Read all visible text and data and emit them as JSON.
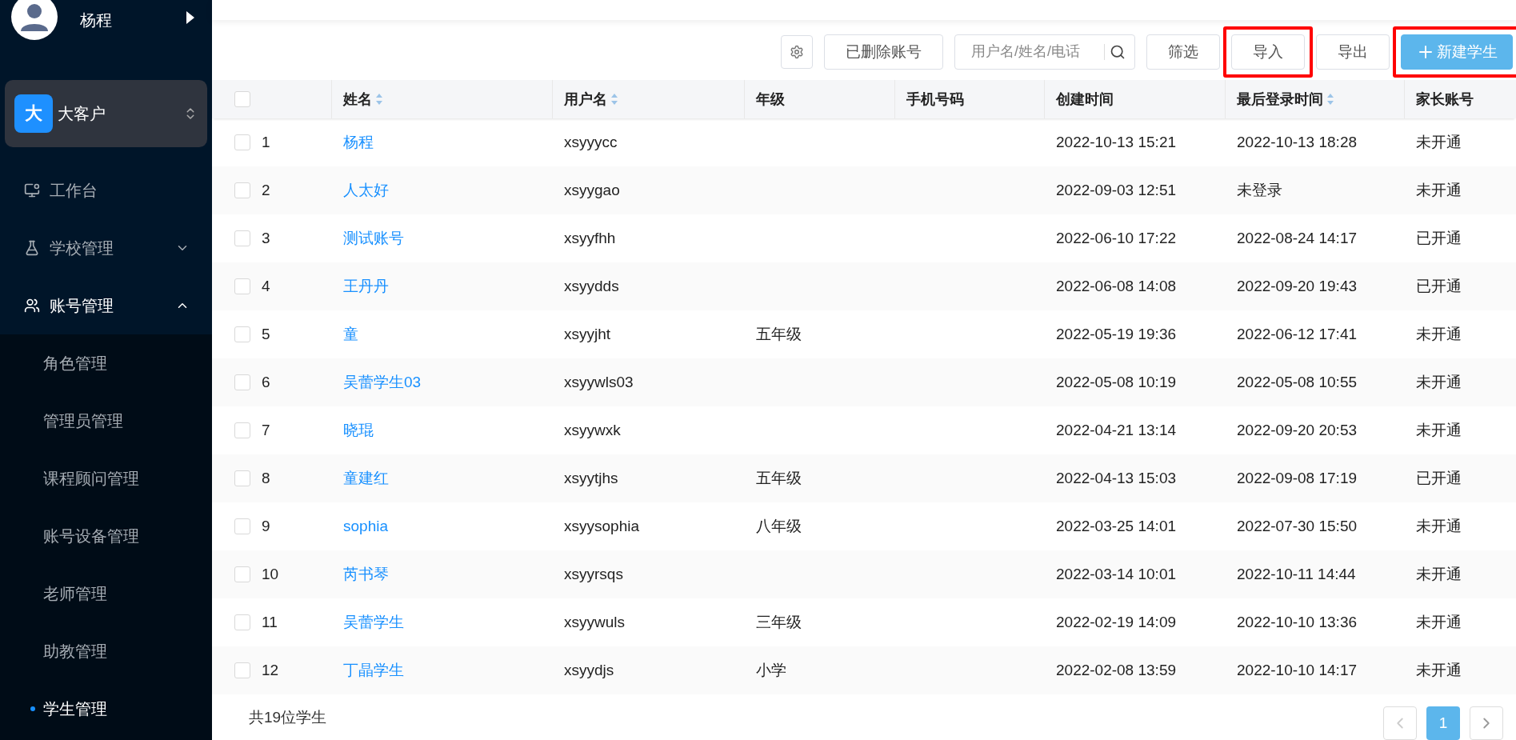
{
  "sidebar": {
    "user": {
      "name": "杨程"
    },
    "org": {
      "badge": "大",
      "name": "大客户"
    },
    "menu": [
      {
        "label": "工作台",
        "expanded": false,
        "has_children": false
      },
      {
        "label": "学校管理",
        "expanded": false,
        "has_children": true
      },
      {
        "label": "账号管理",
        "expanded": true,
        "has_children": true,
        "children": [
          {
            "label": "角色管理",
            "selected": false
          },
          {
            "label": "管理员管理",
            "selected": false
          },
          {
            "label": "课程顾问管理",
            "selected": false
          },
          {
            "label": "账号设备管理",
            "selected": false
          },
          {
            "label": "老师管理",
            "selected": false
          },
          {
            "label": "助教管理",
            "selected": false
          },
          {
            "label": "学生管理",
            "selected": true
          }
        ]
      }
    ]
  },
  "toolbar": {
    "buttons": [
      {
        "kind": "icon",
        "highlighted": false
      },
      {
        "kind": "default",
        "label": "已删除账号",
        "highlighted": false
      },
      {
        "kind": "search",
        "placeholder": "用户名/姓名/电话",
        "highlighted": false
      },
      {
        "kind": "default",
        "label": "筛选",
        "highlighted": false
      },
      {
        "kind": "default",
        "label": "导入",
        "highlighted": true
      },
      {
        "kind": "default",
        "label": "导出",
        "highlighted": false
      },
      {
        "kind": "primary",
        "label": "新建学生",
        "highlighted": true
      }
    ]
  },
  "table": {
    "all_checked": false,
    "columns": [
      {
        "label": "姓名",
        "sortable": true
      },
      {
        "label": "用户名",
        "sortable": true
      },
      {
        "label": "年级",
        "sortable": false
      },
      {
        "label": "手机号码",
        "sortable": false
      },
      {
        "label": "创建时间",
        "sortable": false
      },
      {
        "label": "最后登录时间",
        "sortable": true
      },
      {
        "label": "家长账号",
        "sortable": false
      }
    ],
    "rows": [
      {
        "checked": false,
        "index": "1",
        "cells": [
          "杨程",
          "xsyyycc",
          "",
          "",
          "2022-10-13 15:21",
          "2022-10-13 18:28",
          "未开通"
        ]
      },
      {
        "checked": false,
        "index": "2",
        "cells": [
          "人太好",
          "xsyygao",
          "",
          "",
          "2022-09-03 12:51",
          "未登录",
          "未开通"
        ]
      },
      {
        "checked": false,
        "index": "3",
        "cells": [
          "测试账号",
          "xsyyfhh",
          "",
          "",
          "2022-06-10 17:22",
          "2022-08-24 14:17",
          "已开通"
        ]
      },
      {
        "checked": false,
        "index": "4",
        "cells": [
          "王丹丹",
          "xsyydds",
          "",
          "",
          "2022-06-08 14:08",
          "2022-09-20 19:43",
          "已开通"
        ]
      },
      {
        "checked": false,
        "index": "5",
        "cells": [
          "童",
          "xsyyjht",
          "五年级",
          "",
          "2022-05-19 19:36",
          "2022-06-12 17:41",
          "未开通"
        ]
      },
      {
        "checked": false,
        "index": "6",
        "cells": [
          "吴蕾学生03",
          "xsyywls03",
          "",
          "",
          "2022-05-08 10:19",
          "2022-05-08 10:55",
          "未开通"
        ]
      },
      {
        "checked": false,
        "index": "7",
        "cells": [
          "晓琨",
          "xsyywxk",
          "",
          "",
          "2022-04-21 13:14",
          "2022-09-20 20:53",
          "未开通"
        ]
      },
      {
        "checked": false,
        "index": "8",
        "cells": [
          "童建红",
          "xsyytjhs",
          "五年级",
          "",
          "2022-04-13 15:03",
          "2022-09-08 17:19",
          "已开通"
        ]
      },
      {
        "checked": false,
        "index": "9",
        "cells": [
          "sophia",
          "xsyysophia",
          "八年级",
          "",
          "2022-03-25 14:01",
          "2022-07-30 15:50",
          "未开通"
        ]
      },
      {
        "checked": false,
        "index": "10",
        "cells": [
          "芮书琴",
          "xsyyrsqs",
          "",
          "",
          "2022-03-14 10:01",
          "2022-10-11 14:44",
          "未开通"
        ]
      },
      {
        "checked": false,
        "index": "11",
        "cells": [
          "吴蕾学生",
          "xsyywuls",
          "三年级",
          "",
          "2022-02-19 14:09",
          "2022-10-10 13:36",
          "未开通"
        ]
      },
      {
        "checked": false,
        "index": "12",
        "cells": [
          "丁晶学生",
          "xsyydjs",
          "小学",
          "",
          "2022-02-08 13:59",
          "2022-10-10 14:17",
          "未开通"
        ]
      }
    ]
  },
  "footer": {
    "total": "共19位学生",
    "pagination": {
      "pages": [
        {
          "label": "1",
          "selected": true
        }
      ],
      "prev_disabled": true,
      "next_disabled": false
    }
  }
}
